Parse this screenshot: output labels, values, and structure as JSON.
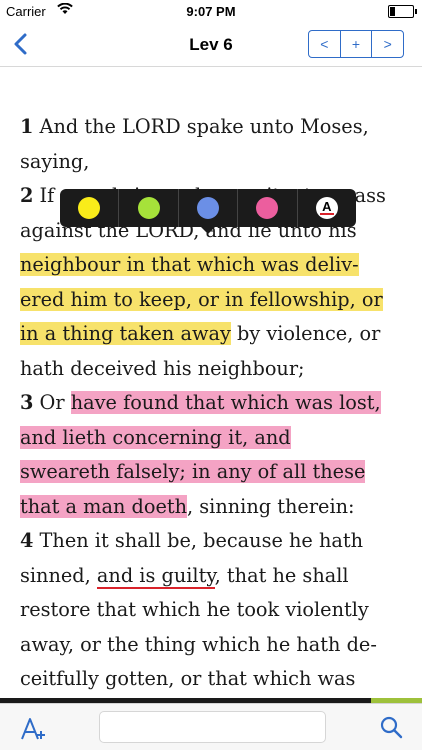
{
  "status": {
    "carrier": "Carrier",
    "time": "9:07 PM"
  },
  "nav": {
    "title": "Lev 6",
    "back_icon": "chevron-left-icon",
    "prev_label": "<",
    "add_label": "+",
    "next_label": ">"
  },
  "passage": {
    "v1_num": "1",
    "v1_a": " And the LORD spake unto Moses,",
    "v1_b": "saying,",
    "v2_num": "2",
    "v2_a": " If ",
    "v2_a_hidden": "a soul sin, and commit a trespass",
    "v2_b": "against the LORD, and lie unto his",
    "v2_c": "neighbour in that which was deliv-",
    "v2_d": "ered him to keep, or in fellowship, or",
    "v2_e_hl": "in a thing taken away",
    "v2_e_rest": " by violence, or",
    "v2_f": "hath deceived his neighbour;",
    "v3_num": "3",
    "v3_a_pre": " Or ",
    "v3_a_hl": "have found that which was lost,",
    "v3_b_hl": "and lieth concerning it, and",
    "v3_c_hl": "sweareth falsely; in any of all these",
    "v3_d_hl": "that a man doeth",
    "v3_d_rest": ", sinning therein:",
    "v4_num": "4",
    "v4_a": " Then it shall be, because he hath",
    "v4_b_pre": "sinned, ",
    "v4_b_ul": "and is guilty",
    "v4_b_rest": ", that he shall",
    "v4_c": "restore that which he took violently",
    "v4_d": "away, or the thing which he hath de-",
    "v4_e": "ceitfully gotten, or that which was"
  },
  "highlight_menu": {
    "colors": [
      "#f9ec1a",
      "#a6e23a",
      "#6b8fe6",
      "#ec5e9e"
    ],
    "text_style_label": "A"
  },
  "reading_progress": 0.88,
  "toolbar": {
    "font_icon": "font-size-icon",
    "search_placeholder": "",
    "search_icon": "search-icon"
  }
}
